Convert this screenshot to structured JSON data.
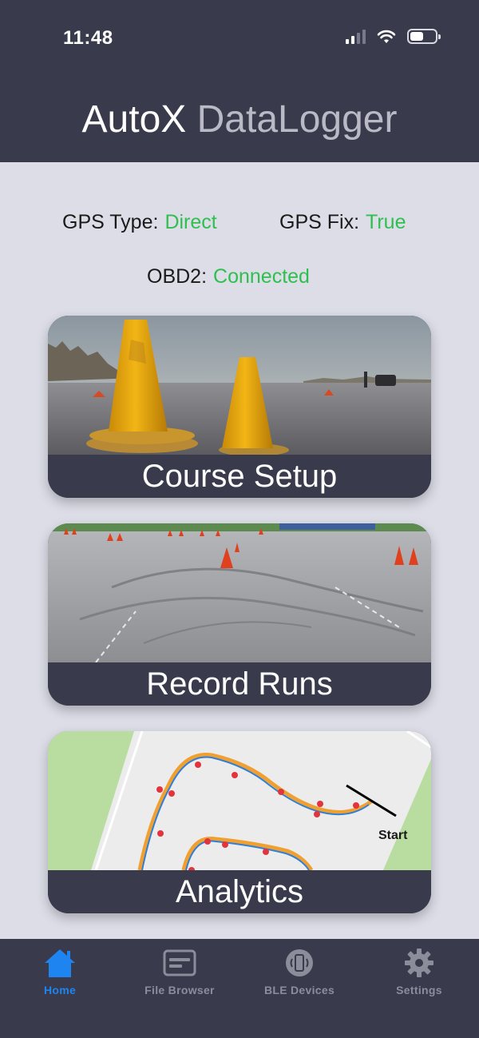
{
  "status_bar": {
    "time": "11:48",
    "icons": [
      "cellular-signal-icon",
      "wifi-icon",
      "battery-icon"
    ]
  },
  "app": {
    "title_part1": "AutoX",
    "title_part2": "DataLogger"
  },
  "status": {
    "gps_type_label": "GPS Type:",
    "gps_type_value": "Direct",
    "gps_fix_label": "GPS Fix:",
    "gps_fix_value": "True",
    "obd2_label": "OBD2:",
    "obd2_value": "Connected"
  },
  "cards": {
    "course_setup": "Course Setup",
    "record_runs": "Record Runs",
    "analytics": "Analytics",
    "map_start_label": "Start"
  },
  "tabs": [
    {
      "label": "Home",
      "icon": "house-icon",
      "active": true
    },
    {
      "label": "File Browser",
      "icon": "file-browser-icon",
      "active": false
    },
    {
      "label": "BLE Devices",
      "icon": "bluetooth-device-icon",
      "active": false
    },
    {
      "label": "Settings",
      "icon": "gear-icon",
      "active": false
    }
  ],
  "colors": {
    "header_bg": "#393b4d",
    "page_bg": "#dcdde7",
    "status_value_green": "#2fbf4f",
    "tab_active": "#1e84f0",
    "tab_inactive": "#8b8d9a"
  }
}
